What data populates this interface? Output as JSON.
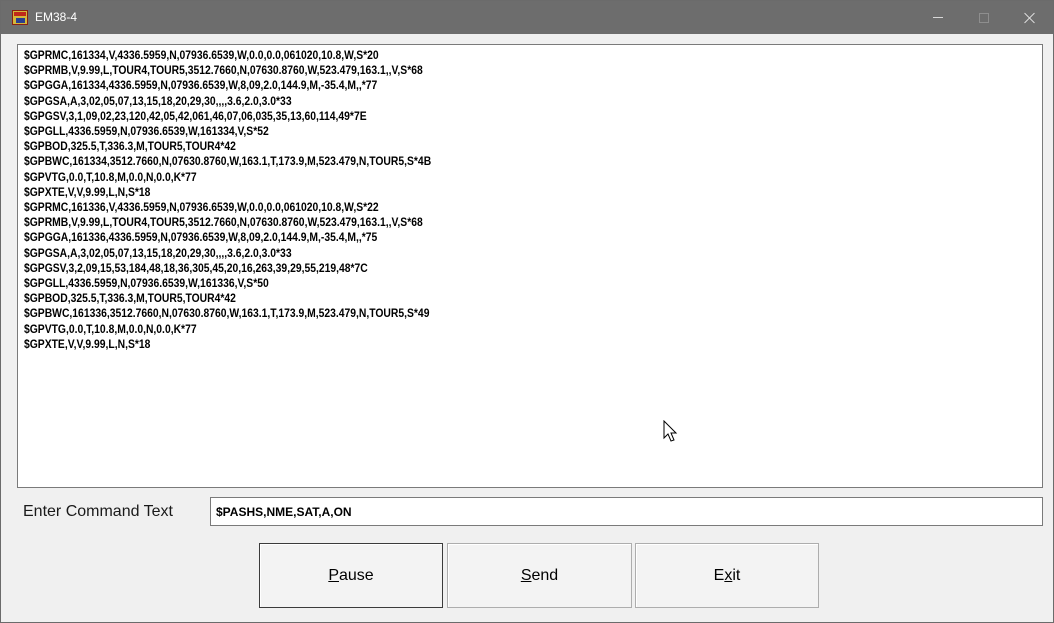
{
  "window": {
    "title": "EM38-4",
    "icon": "em38-app-icon"
  },
  "output": {
    "lines": [
      "$GPRMC,161334,V,4336.5959,N,07936.6539,W,0.0,0.0,061020,10.8,W,S*20",
      "$GPRMB,V,9.99,L,TOUR4,TOUR5,3512.7660,N,07630.8760,W,523.479,163.1,,V,S*68",
      "$GPGGA,161334,4336.5959,N,07936.6539,W,8,09,2.0,144.9,M,-35.4,M,,*77",
      "$GPGSA,A,3,02,05,07,13,15,18,20,29,30,,,,3.6,2.0,3.0*33",
      "$GPGSV,3,1,09,02,23,120,42,05,42,061,46,07,06,035,35,13,60,114,49*7E",
      "$GPGLL,4336.5959,N,07936.6539,W,161334,V,S*52",
      "$GPBOD,325.5,T,336.3,M,TOUR5,TOUR4*42",
      "$GPBWC,161334,3512.7660,N,07630.8760,W,163.1,T,173.9,M,523.479,N,TOUR5,S*4B",
      "$GPVTG,0.0,T,10.8,M,0.0,N,0.0,K*77",
      "$GPXTE,V,V,9.99,L,N,S*18",
      "$GPRMC,161336,V,4336.5959,N,07936.6539,W,0.0,0.0,061020,10.8,W,S*22",
      "$GPRMB,V,9.99,L,TOUR4,TOUR5,3512.7660,N,07630.8760,W,523.479,163.1,,V,S*68",
      "$GPGGA,161336,4336.5959,N,07936.6539,W,8,09,2.0,144.9,M,-35.4,M,,*75",
      "$GPGSA,A,3,02,05,07,13,15,18,20,29,30,,,,3.6,2.0,3.0*33",
      "$GPGSV,3,2,09,15,53,184,48,18,36,305,45,20,16,263,39,29,55,219,48*7C",
      "$GPGLL,4336.5959,N,07936.6539,W,161336,V,S*50",
      "$GPBOD,325.5,T,336.3,M,TOUR5,TOUR4*42",
      "$GPBWC,161336,3512.7660,N,07630.8760,W,163.1,T,173.9,M,523.479,N,TOUR5,S*49",
      "$GPVTG,0.0,T,10.8,M,0.0,N,0.0,K*77",
      "$GPXTE,V,V,9.99,L,N,S*18"
    ]
  },
  "command": {
    "label": "Enter Command Text",
    "value": "$PASHS,NME,SAT,A,ON"
  },
  "buttons": {
    "pause": {
      "mnemonic": "P",
      "rest": "ause"
    },
    "send": {
      "mnemonic": "S",
      "rest": "end"
    },
    "exit": {
      "before": "E",
      "mnemonic": "x",
      "after": "it"
    }
  }
}
